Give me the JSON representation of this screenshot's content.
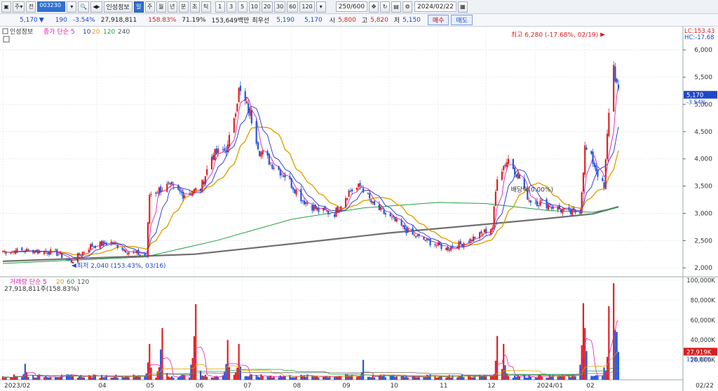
{
  "toolbar": {
    "period_buttons": [
      "일",
      "주",
      "월",
      "년",
      "분",
      "초",
      "틱"
    ],
    "minute_buttons": [
      "1",
      "3",
      "5",
      "10",
      "20",
      "30",
      "60",
      "120"
    ],
    "stock_code": "003230",
    "info_label": "인성정보",
    "count_value": "250/600",
    "date_value": "2024/02/22"
  },
  "quote": {
    "price": "5,170",
    "change": "190",
    "change_pct": "-3.54%",
    "volume": "27,918,811",
    "vol_ratio": "158.83%",
    "turnover": "71.19%",
    "amount": "153,649백만",
    "best_label": "최우선",
    "best_ask": "5,190",
    "best_bid": "5,170",
    "open_label": "시",
    "open": "5,800",
    "high_label": "고",
    "high": "5,820",
    "low_label": "저",
    "low": "5,150",
    "buy_label": "매수",
    "sell_label": "매도"
  },
  "chart_data": [
    {
      "type": "candlestick",
      "legend": [
        "인성정보",
        "종가 단순 5",
        "10",
        "20",
        "120",
        "240"
      ],
      "lc_label": "LC:153.43",
      "hc_label": "HC:-17.68",
      "current_label": "5,170",
      "current_pct": "-3.54%",
      "ylim": [
        1900,
        6350
      ],
      "y_ticks": [
        2000,
        2500,
        3000,
        3500,
        4000,
        4500,
        5000,
        5500,
        6000
      ],
      "y_tick_labels": [
        "2,000",
        "2,500",
        "3,000",
        "3,500",
        "4,000",
        "4,500",
        "5,000",
        "5,500",
        "6,000"
      ],
      "x_months": [
        "2023/02",
        "04",
        "05",
        "06",
        "07",
        "08",
        "09",
        "10",
        "11",
        "12",
        "2024/01",
        "02",
        "02/22"
      ],
      "annotations": {
        "high": "최고 6,280 (-17.68%, 02/19)",
        "low": "최저 2,040 (153.43%, 03/16)",
        "mid": "배당락(0.00%)"
      },
      "close_path": [
        [
          "2023-02-01",
          2300
        ],
        [
          "2023-02-20",
          2320
        ],
        [
          "2023-03-06",
          2280
        ],
        [
          "2023-03-16",
          2120
        ],
        [
          "2023-03-28",
          2400
        ],
        [
          "2023-04-10",
          2470
        ],
        [
          "2023-04-21",
          2300
        ],
        [
          "2023-05-02",
          2220
        ],
        [
          "2023-05-04",
          3350
        ],
        [
          "2023-05-15",
          3500
        ],
        [
          "2023-05-25",
          3350
        ],
        [
          "2023-06-05",
          3450
        ],
        [
          "2023-06-12",
          4050
        ],
        [
          "2023-06-22",
          4200
        ],
        [
          "2023-06-29",
          5250
        ],
        [
          "2023-07-06",
          4850
        ],
        [
          "2023-07-12",
          4150
        ],
        [
          "2023-07-20",
          3900
        ],
        [
          "2023-07-28",
          3700
        ],
        [
          "2023-08-08",
          3250
        ],
        [
          "2023-08-18",
          3050
        ],
        [
          "2023-08-28",
          3000
        ],
        [
          "2023-09-06",
          3400
        ],
        [
          "2023-09-14",
          3500
        ],
        [
          "2023-09-21",
          3150
        ],
        [
          "2023-10-05",
          2850
        ],
        [
          "2023-10-16",
          2600
        ],
        [
          "2023-10-26",
          2480
        ],
        [
          "2023-11-06",
          2350
        ],
        [
          "2023-11-16",
          2450
        ],
        [
          "2023-11-27",
          2600
        ],
        [
          "2023-12-05",
          2750
        ],
        [
          "2023-12-08",
          3700
        ],
        [
          "2023-12-15",
          4000
        ],
        [
          "2023-12-22",
          3650
        ],
        [
          "2023-12-28",
          3250
        ],
        [
          "2024-01-10",
          3150
        ],
        [
          "2024-01-22",
          3000
        ],
        [
          "2024-01-29",
          3050
        ],
        [
          "2024-02-01",
          4200
        ],
        [
          "2024-02-06",
          3950
        ],
        [
          "2024-02-13",
          3450
        ],
        [
          "2024-02-16",
          4900
        ],
        [
          "2024-02-19",
          5700
        ],
        [
          "2024-02-22",
          5170
        ]
      ],
      "ma240_path": [
        [
          "2023-02-01",
          2120
        ],
        [
          "2023-06-01",
          2250
        ],
        [
          "2023-08-01",
          2440
        ],
        [
          "2023-10-01",
          2640
        ],
        [
          "2023-12-01",
          2800
        ],
        [
          "2024-01-10",
          2910
        ],
        [
          "2024-02-06",
          2990
        ],
        [
          "2024-02-22",
          3120
        ]
      ],
      "ma120_path": [
        [
          "2023-02-01",
          2080
        ],
        [
          "2023-05-01",
          2200
        ],
        [
          "2023-06-15",
          2500
        ],
        [
          "2023-08-01",
          2890
        ],
        [
          "2023-09-15",
          3100
        ],
        [
          "2023-11-01",
          3200
        ],
        [
          "2023-12-01",
          3180
        ],
        [
          "2024-01-10",
          3050
        ],
        [
          "2024-02-06",
          3020
        ],
        [
          "2024-02-22",
          3110
        ]
      ]
    },
    {
      "type": "bar",
      "legend": [
        "거래량 단순 5",
        "20",
        "60",
        "120"
      ],
      "volume_label": "27,918,811주(158.83%)",
      "current_label": "27,919K",
      "current_pct": "158.83%",
      "ylim": [
        0,
        100000
      ],
      "y_ticks": [
        20000,
        40000,
        60000,
        80000,
        100000
      ],
      "y_tick_labels": [
        "20,000K",
        "40,000K",
        "60,000K",
        "80,000K",
        "100,000K"
      ],
      "spikes": [
        [
          "2023-02-15",
          16000
        ],
        [
          "2023-05-04",
          36000
        ],
        [
          "2023-05-12",
          52000
        ],
        [
          "2023-06-02",
          76000
        ],
        [
          "2023-06-22",
          40000
        ],
        [
          "2023-06-29",
          36000
        ],
        [
          "2023-09-15",
          20000
        ],
        [
          "2023-12-08",
          44000
        ],
        [
          "2023-12-12",
          36000
        ],
        [
          "2024-01-31",
          77000
        ],
        [
          "2024-02-01",
          52000
        ],
        [
          "2024-02-16",
          74000
        ],
        [
          "2024-02-19",
          97000
        ],
        [
          "2024-02-20",
          50000
        ],
        [
          "2024-02-21",
          48000
        ],
        [
          "2024-02-22",
          28000
        ]
      ]
    }
  ]
}
